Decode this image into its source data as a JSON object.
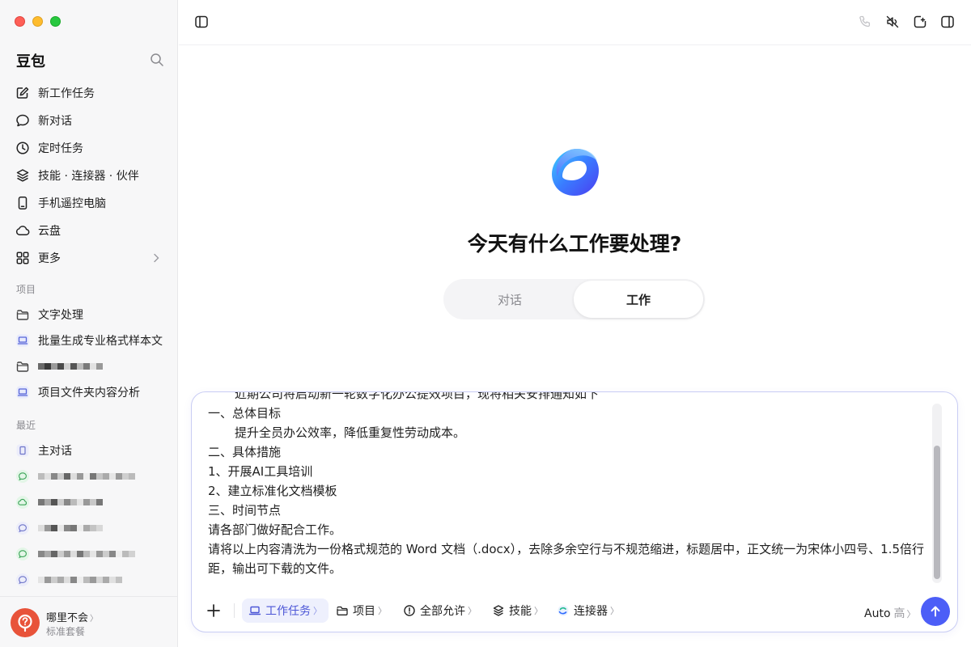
{
  "sidebar": {
    "brand": "豆包",
    "menu": [
      {
        "label": "新工作任务",
        "icon": "edit-icon"
      },
      {
        "label": "新对话",
        "icon": "chat-bubble-icon"
      },
      {
        "label": "定时任务",
        "icon": "clock-icon"
      },
      {
        "label": "技能 · 连接器 · 伙伴",
        "icon": "layers-icon"
      },
      {
        "label": "手机遥控电脑",
        "icon": "phone-icon"
      },
      {
        "label": "云盘",
        "icon": "cloud-icon"
      },
      {
        "label": "更多",
        "icon": "grid-icon"
      }
    ],
    "projects_label": "项目",
    "projects": [
      {
        "label": "文字处理",
        "icon": "folder-icon"
      },
      {
        "label": "批量生成专业格式样本文",
        "icon": "laptop-icon"
      },
      {
        "label": "",
        "icon": "folder-icon",
        "redacted": true
      },
      {
        "label": "项目文件夹内容分析",
        "icon": "laptop-icon"
      }
    ],
    "recent_label": "最近",
    "recent": [
      {
        "label": "主对话",
        "icon": "doc-icon"
      },
      {
        "label": "",
        "icon": "chat-green-icon",
        "redacted": true
      },
      {
        "label": "",
        "icon": "cloud-green-icon",
        "redacted": true
      },
      {
        "label": "",
        "icon": "chat-purple-icon",
        "redacted": true
      },
      {
        "label": "",
        "icon": "chat-green-icon",
        "redacted": true
      },
      {
        "label": "",
        "icon": "chat-purple-icon",
        "redacted": true
      }
    ],
    "user": {
      "name": "哪里不会",
      "plan": "标准套餐",
      "chevron": "〉"
    }
  },
  "main": {
    "headline": "今天有什么工作要处理?",
    "modes": {
      "chat": "对话",
      "work": "工作",
      "selected": "工作"
    }
  },
  "composer": {
    "lines": [
      "近期公司将启动新一轮数字化办公提效项目，现将相关安排通知如下",
      "一、总体目标",
      "提升全员办公效率，降低重复性劳动成本。",
      "二、具体措施",
      "1、开展AI工具培训",
      "2、建立标准化文档模板",
      "三、时间节点",
      "请各部门做好配合工作。",
      "请将以上内容清洗为一份格式规范的 Word 文档（.docx），去除多余空行与不规范缩进，标题居中，正文统一为宋体小四号、1.5倍行距，输出可下载的文件。"
    ],
    "toolbar": {
      "work_task": "工作任务",
      "project": "项目",
      "permission": "全部允许",
      "skills": "技能",
      "connectors": "连接器",
      "chevron": "〉",
      "model": "Auto",
      "level": "高"
    }
  },
  "colors": {
    "accent": "#4c5ef7",
    "composer_border": "#c9cdf4",
    "sidebar_bg": "#f7f7f8",
    "avatar": "#e8533a"
  }
}
